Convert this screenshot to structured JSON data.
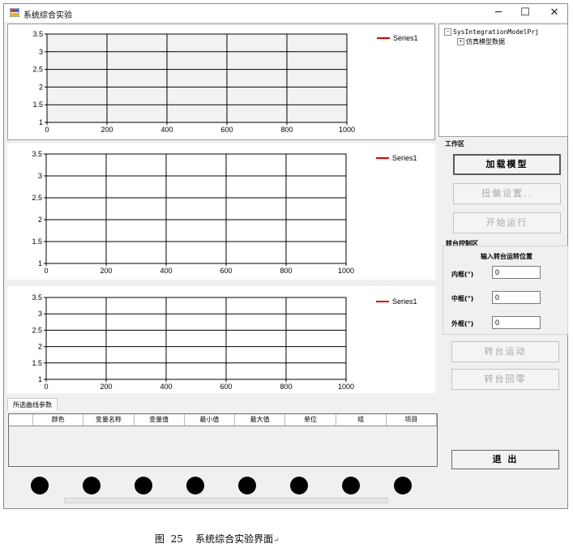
{
  "window": {
    "title": "系统综合实验",
    "controls": {
      "minimize": "─",
      "maximize": "☐",
      "close": "✕"
    }
  },
  "charts": [
    {
      "legend": "Series1",
      "series_color": "#e00000",
      "x_ticks": [
        "0",
        "200",
        "400",
        "600",
        "800",
        "1000"
      ],
      "y_ticks": [
        "1",
        "1.5",
        "2",
        "2.5",
        "3",
        "3.5"
      ]
    },
    {
      "legend": "Series1",
      "series_color": "#e00000",
      "x_ticks": [
        "0",
        "200",
        "400",
        "600",
        "800",
        "1000"
      ],
      "y_ticks": [
        "1",
        "1.5",
        "2",
        "2.5",
        "3",
        "3.5"
      ]
    },
    {
      "legend": "Series1",
      "series_color": "#e00000",
      "x_ticks": [
        "0",
        "200",
        "400",
        "600",
        "800",
        "1000"
      ],
      "y_ticks": [
        "1",
        "1.5",
        "2",
        "2.5",
        "3",
        "3.5"
      ]
    }
  ],
  "chart_data": [
    {
      "type": "line",
      "series": [
        {
          "name": "Series1",
          "values": []
        }
      ],
      "xlim": [
        0,
        1000
      ],
      "ylim": [
        1,
        3.5
      ],
      "grid": true,
      "legend": "top-right"
    },
    {
      "type": "line",
      "series": [
        {
          "name": "Series1",
          "values": []
        }
      ],
      "xlim": [
        0,
        1000
      ],
      "ylim": [
        1,
        3.5
      ],
      "grid": true,
      "legend": "top-right"
    },
    {
      "type": "line",
      "series": [
        {
          "name": "Series1",
          "values": []
        }
      ],
      "xlim": [
        0,
        1000
      ],
      "ylim": [
        1,
        3.5
      ],
      "grid": true,
      "legend": "top-right"
    }
  ],
  "tree": {
    "root": "SysIntegrationModelPrj",
    "child": "仿真模型数据",
    "root_toggle": "−",
    "child_toggle": "+"
  },
  "workspace": {
    "label": "工作区",
    "load_model": "加载模型",
    "flux_settings": "扭偏设置..",
    "start_run": "开始运行"
  },
  "turntable": {
    "label": "转台控制区",
    "prompt": "输入转台运转位置",
    "inner_label": "内框(°)",
    "inner_value": "0",
    "middle_label": "中框(°)",
    "middle_value": "0",
    "outer_label": "外框(°)",
    "outer_value": "0",
    "move": "转台运动",
    "zero": "转台回零"
  },
  "exit": "退  出",
  "curve_params": {
    "tab": "所选曲线参数",
    "columns": [
      "颜色",
      "变量名称",
      "变量值",
      "最小值",
      "最大值",
      "单位",
      "组",
      "项目"
    ]
  },
  "indicators_count": 8,
  "caption": "图  25    系统综合实验界面",
  "caption_mark": "↵"
}
